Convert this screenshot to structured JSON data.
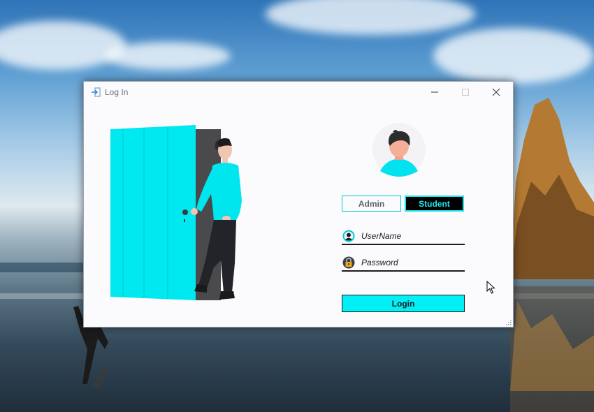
{
  "window": {
    "title": "Log In",
    "app_icon": "login-arrow-icon",
    "controls": [
      "minimize-icon",
      "maximize-icon",
      "close-icon"
    ]
  },
  "illustration": {
    "icon": "person-opening-door-illustration"
  },
  "avatar": {
    "icon": "user-avatar-icon"
  },
  "roles": {
    "admin_label": "Admin",
    "student_label": "Student",
    "selected": "Student"
  },
  "username": {
    "placeholder": "UserName",
    "value": "",
    "icon": "user-icon"
  },
  "password": {
    "placeholder": "Password",
    "value": "",
    "icon": "lock-icon"
  },
  "login": {
    "label": "Login"
  },
  "colors": {
    "accent": "#00F0F6",
    "selected_bg": "#000000",
    "selected_text": "#1DE9F0",
    "window_bg": "#FBFBFE"
  }
}
